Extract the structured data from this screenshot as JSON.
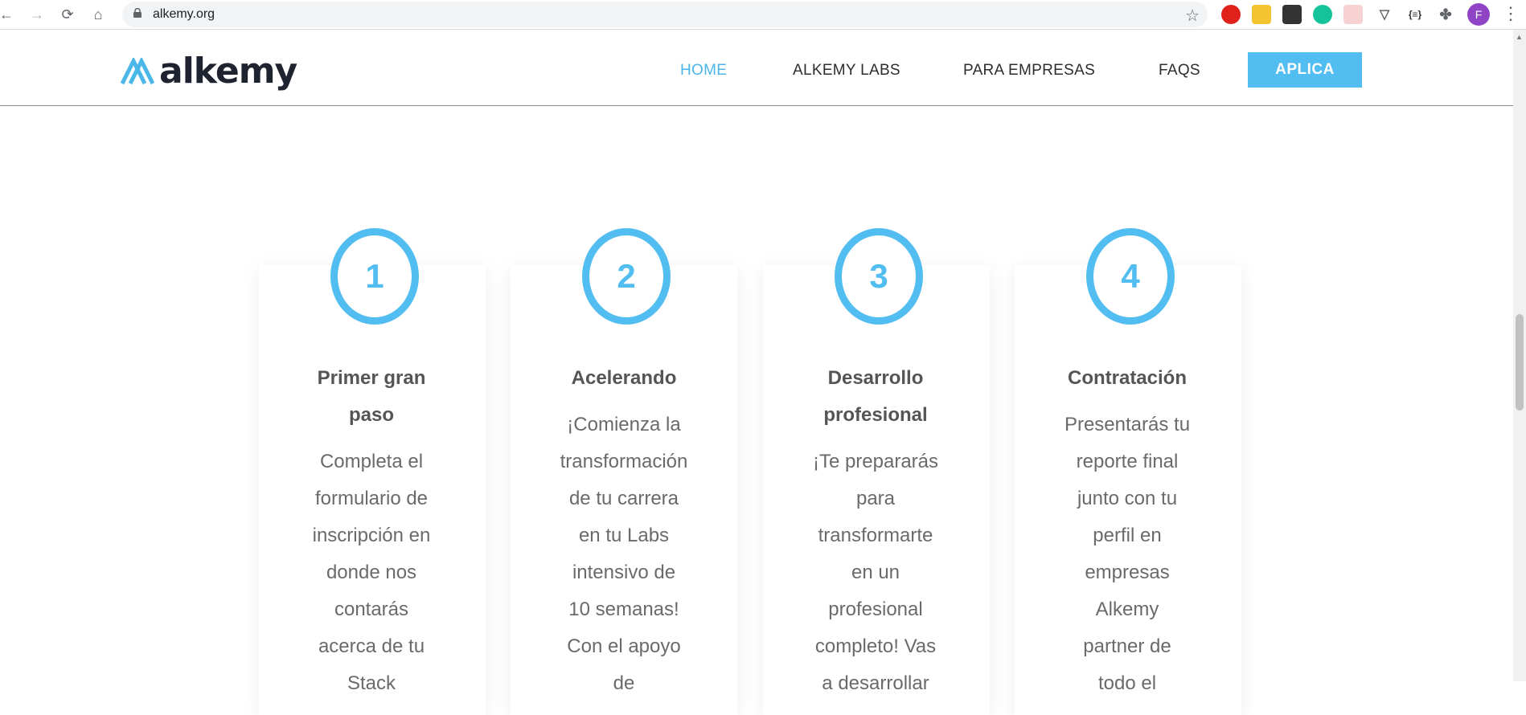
{
  "browser": {
    "url": "alkemy.org",
    "profile_initial": "F"
  },
  "header": {
    "logo_text": "alkemy",
    "nav": {
      "home": "HOME",
      "labs": "ALKEMY LABS",
      "empresas": "PARA EMPRESAS",
      "faqs": "FAQS"
    },
    "cta": "APLICA"
  },
  "steps": [
    {
      "number": "1",
      "title_lines": [
        "Primer gran",
        "paso"
      ],
      "desc_lines": [
        "Completa el",
        "formulario de",
        "inscripción en",
        "donde nos",
        "contarás",
        "acerca de tu",
        "Stack"
      ]
    },
    {
      "number": "2",
      "title_lines": [
        "Acelerando"
      ],
      "desc_lines": [
        "¡Comienza la",
        "transformación",
        "de tu carrera",
        "en tu Labs",
        "intensivo de",
        "10 semanas!",
        "Con el apoyo",
        "de"
      ]
    },
    {
      "number": "3",
      "title_lines": [
        "Desarrollo",
        "profesional"
      ],
      "desc_lines": [
        "¡Te prepararás",
        "para",
        "transformarte",
        "en un",
        "profesional",
        "completo! Vas",
        "a desarrollar"
      ]
    },
    {
      "number": "4",
      "title_lines": [
        "Contratación"
      ],
      "desc_lines": [
        "Presentarás tu",
        "reporte final",
        "junto con tu",
        "perfil en",
        "empresas",
        "Alkemy",
        "partner de",
        "todo el"
      ]
    }
  ],
  "colors": {
    "accent": "#52bdf0",
    "nav_active": "#4bb6e8",
    "title": "#555555",
    "body_text": "#6a6a6a"
  }
}
